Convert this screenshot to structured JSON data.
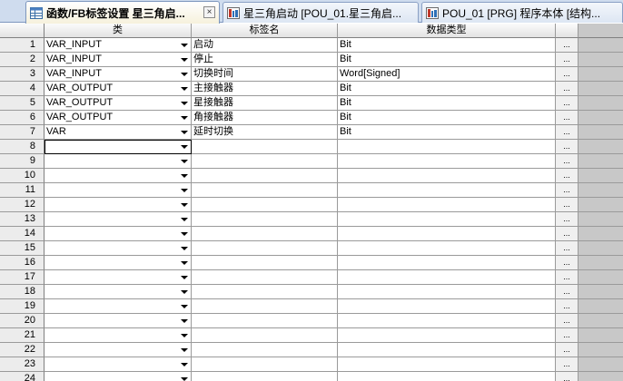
{
  "tabs": [
    {
      "label": "函数/FB标签设置 星三角启...",
      "active": true,
      "icon": "label-table-icon"
    },
    {
      "label": "星三角启动 [POU_01.星三角启...",
      "active": false,
      "icon": "program-icon"
    },
    {
      "label": "POU_01 [PRG] 程序本体 [结构...",
      "active": false,
      "icon": "program-icon"
    }
  ],
  "close_glyph": "×",
  "columns": {
    "class": "类",
    "label_name": "标签名",
    "data_type": "数据类型"
  },
  "button_glyph": "...",
  "rows": [
    {
      "num": "1",
      "class": "VAR_INPUT",
      "name": "启动",
      "type": "Bit"
    },
    {
      "num": "2",
      "class": "VAR_INPUT",
      "name": "停止",
      "type": "Bit"
    },
    {
      "num": "3",
      "class": "VAR_INPUT",
      "name": "切换时间",
      "type": "Word[Signed]"
    },
    {
      "num": "4",
      "class": "VAR_OUTPUT",
      "name": "主接触器",
      "type": "Bit"
    },
    {
      "num": "5",
      "class": "VAR_OUTPUT",
      "name": "星接触器",
      "type": "Bit"
    },
    {
      "num": "6",
      "class": "VAR_OUTPUT",
      "name": "角接触器",
      "type": "Bit"
    },
    {
      "num": "7",
      "class": "VAR",
      "name": "延时切换",
      "type": "Bit"
    },
    {
      "num": "8",
      "class": "",
      "name": "",
      "type": "",
      "selected": true
    },
    {
      "num": "9",
      "class": "",
      "name": "",
      "type": ""
    },
    {
      "num": "10",
      "class": "",
      "name": "",
      "type": ""
    },
    {
      "num": "11",
      "class": "",
      "name": "",
      "type": ""
    },
    {
      "num": "12",
      "class": "",
      "name": "",
      "type": ""
    },
    {
      "num": "13",
      "class": "",
      "name": "",
      "type": ""
    },
    {
      "num": "14",
      "class": "",
      "name": "",
      "type": ""
    },
    {
      "num": "15",
      "class": "",
      "name": "",
      "type": ""
    },
    {
      "num": "16",
      "class": "",
      "name": "",
      "type": ""
    },
    {
      "num": "17",
      "class": "",
      "name": "",
      "type": ""
    },
    {
      "num": "18",
      "class": "",
      "name": "",
      "type": ""
    },
    {
      "num": "19",
      "class": "",
      "name": "",
      "type": ""
    },
    {
      "num": "20",
      "class": "",
      "name": "",
      "type": ""
    },
    {
      "num": "21",
      "class": "",
      "name": "",
      "type": ""
    },
    {
      "num": "22",
      "class": "",
      "name": "",
      "type": ""
    },
    {
      "num": "23",
      "class": "",
      "name": "",
      "type": ""
    },
    {
      "num": "24",
      "class": "",
      "name": "",
      "type": ""
    }
  ]
}
